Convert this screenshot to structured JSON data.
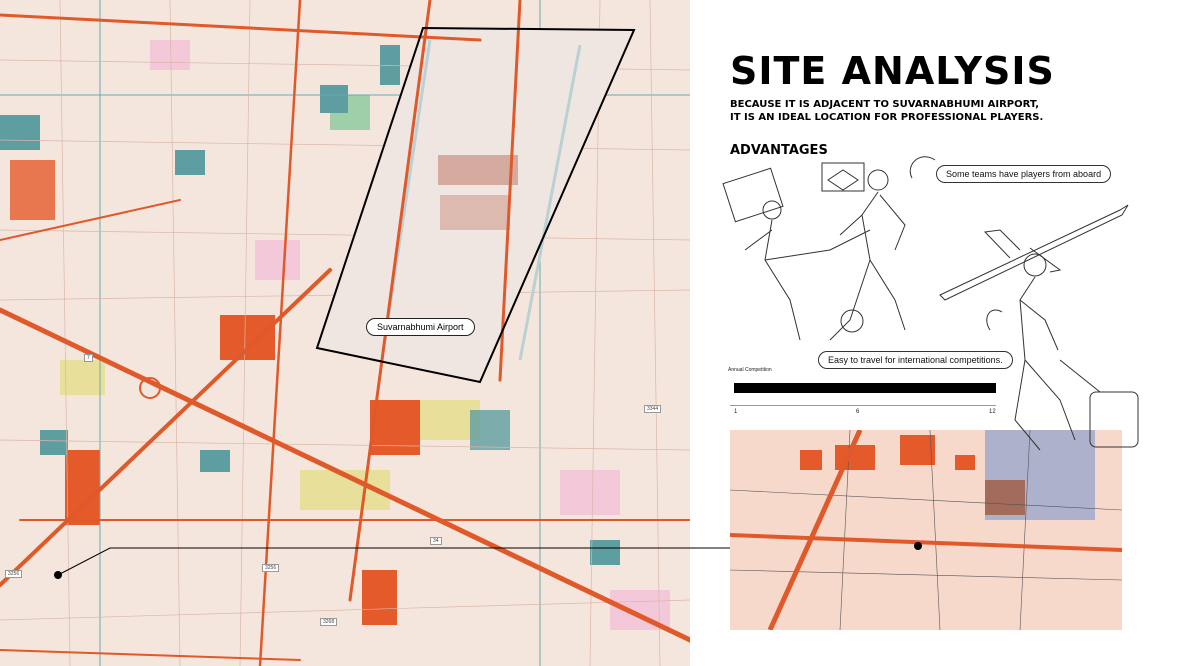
{
  "title": "SITE ANALYSIS",
  "subtitle_lines": [
    "BECAUSE IT IS ADJACENT TO SUVARNABHUMI AIRPORT,",
    "IT IS AN IDEAL LOCATION FOR PROFESSIONAL PLAYERS."
  ],
  "advantages_heading": "ADVANTAGES",
  "callouts": {
    "teams": "Some teams have players from aboard",
    "travel": "Easy to travel for international competitions."
  },
  "map": {
    "airport_label": "Suvarnabhumi Airport",
    "road_numbers": [
      "3256",
      "34",
      "3256",
      "3268",
      "7",
      "3344"
    ]
  },
  "annual_bar": {
    "caption": "Annual Competition",
    "value": 12,
    "min": 1,
    "max": 12,
    "ticks": [
      "1",
      "6",
      "12"
    ]
  },
  "colors": {
    "map_background": "#f4e6dc",
    "major_road": "#e0592a",
    "minor_road": "#c96a52",
    "water": "#5f9ea0",
    "orange_zone": "#e55a2b",
    "yellow_zone": "#e8df9a",
    "pink_zone": "#f3c9d9",
    "green_zone": "#9ecfa8",
    "inset_background": "#f7d9cc",
    "inset_blue": "#9aa6cc",
    "inset_brown": "#a36b5a"
  }
}
